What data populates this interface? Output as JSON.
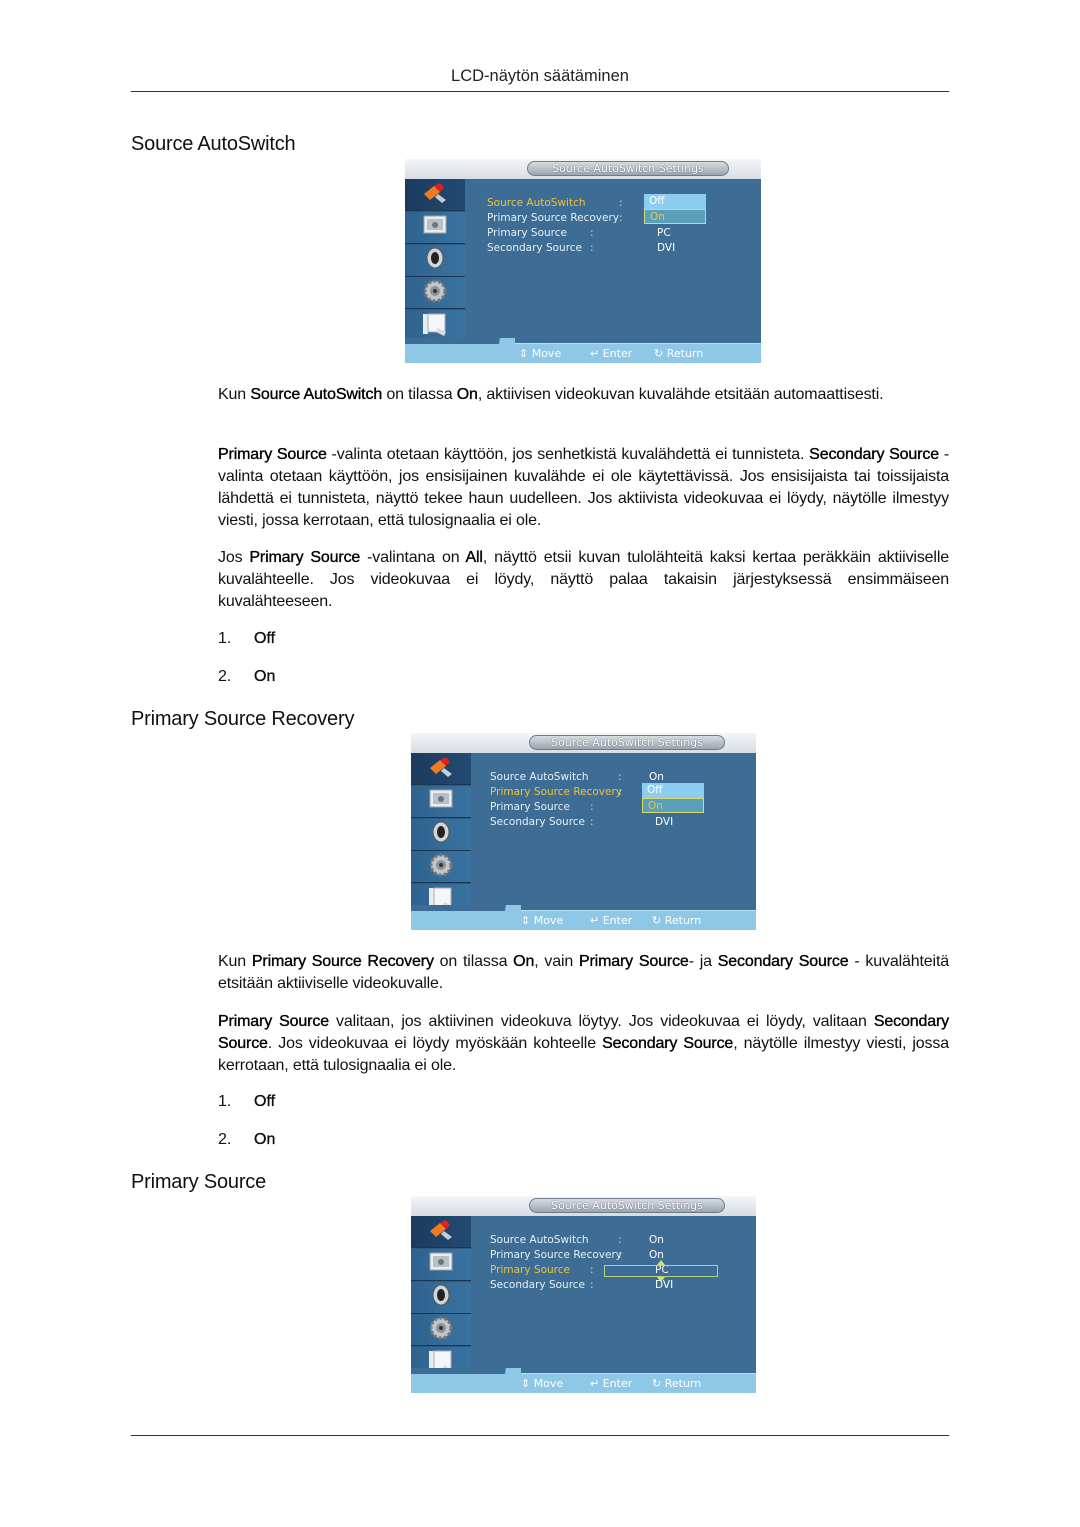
{
  "header": {
    "title": "LCD-näytön säätäminen"
  },
  "sections": [
    {
      "title": "Source AutoSwitch",
      "paragraphs": [
        [
          "Kun ",
          {
            "b": "Source AutoSwitch"
          },
          " on tilassa ",
          {
            "b": "On"
          },
          ", aktiivisen videokuvan kuvalähde etsitään automaat­tisesti."
        ],
        [
          {
            "b": "Primary Source"
          },
          " -valinta otetaan käyttöön, jos senhetkistä kuvalähdettä ei tunnisteta. ",
          {
            "b": "Secon­dary Source"
          },
          " -valinta otetaan käyttöön, jos ensisijainen kuvalähde ei ole käytettävissä. Jos ensisijaista tai toissijaista lähdettä ei tunnisteta, näyttö tekee haun uudelleen. Jos aktiivista videokuvaa ei löydy, näytölle ilmestyy viesti, jossa kerrotaan, että tulosignaalia ei ole."
        ],
        [
          "Jos ",
          {
            "b": "Primary Source"
          },
          " -valintana on ",
          {
            "b": "All"
          },
          ", näyttö etsii kuvan tulolähteitä kaksi kertaa peräkkäin aktiiviselle kuvalähteelle. Jos videokuvaa ei löydy, näyttö palaa takaisin järjestyksessä en­simmäiseen kuvalähteeseen."
        ]
      ],
      "options": [
        {
          "num": "1.",
          "label": "Off"
        },
        {
          "num": "2.",
          "label": "On"
        }
      ]
    },
    {
      "title": "Primary Source Recovery",
      "paragraphs": [
        [
          "Kun ",
          {
            "b": "Primary Source Recovery"
          },
          " on tilassa ",
          {
            "b": "On"
          },
          ", vain ",
          {
            "b": "Primary Source"
          },
          "- ja ",
          {
            "b": "Secondary Source"
          },
          " - kuvalähteitä etsitään aktiiviselle videokuvalle."
        ],
        [
          {
            "b": "Primary Source"
          },
          " valitaan, jos aktiivinen videokuva löytyy. Jos videokuvaa ei löydy, valitaan ",
          {
            "b": "Secondary Source"
          },
          ". Jos videokuvaa ei löydy myöskään kohteelle ",
          {
            "b": "Secondary Source"
          },
          ", näytölle ilmestyy viesti, jossa kerrotaan, että tulosignaalia ei ole."
        ]
      ],
      "options": [
        {
          "num": "1.",
          "label": "Off"
        },
        {
          "num": "2.",
          "label": "On"
        }
      ]
    },
    {
      "title": "Primary Source",
      "paragraphs": [],
      "options": []
    }
  ],
  "osd": {
    "title": "Source AutoSwitch Settings",
    "sidebar_icons": [
      "input-icon",
      "picture-icon",
      "sound-icon",
      "setup-icon",
      "multi-control-icon"
    ],
    "labels": [
      "Source AutoSwitch",
      "Primary Source Recovery",
      "Primary Source",
      "Secondary Source"
    ],
    "hints": {
      "move": "Move",
      "enter": "Enter",
      "return": "Return"
    },
    "screens": [
      {
        "selected_row": 0,
        "values": [
          "",
          "",
          "PC",
          "DVI"
        ],
        "dropdown": {
          "row": 0,
          "options": [
            "Off",
            "On"
          ],
          "highlighted": "On"
        }
      },
      {
        "selected_row": 1,
        "values": [
          "On",
          "",
          "",
          "DVI"
        ],
        "dropdown": {
          "row": 1,
          "options": [
            "Off",
            "On"
          ],
          "highlighted": "On"
        }
      },
      {
        "selected_row": 2,
        "values": [
          "On",
          "On",
          "PC",
          "DVI"
        ],
        "picker": {
          "row": 2,
          "value": "PC"
        }
      }
    ]
  }
}
